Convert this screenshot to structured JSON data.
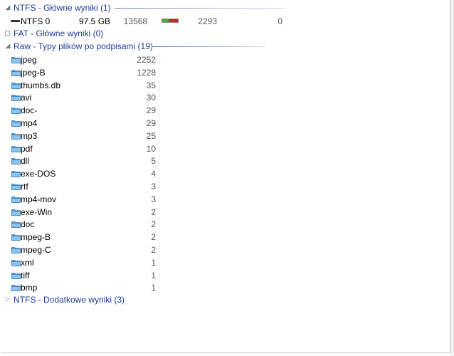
{
  "groups": {
    "ntfs_main": {
      "title": "NTFS - Główne wyniki (1)"
    },
    "fat_main": {
      "title": "FAT - Główne wyniki (0)"
    },
    "raw": {
      "title": "Raw - Typy plików po podpisami (19)"
    },
    "ntfs_extra": {
      "title": "NTFS - Dodatkowe wyniki (3)"
    }
  },
  "ntfs_row": {
    "name": "NTFS 0",
    "size": "97.5 GB",
    "value1": "13568",
    "bar_fill_fraction": 0.4,
    "value2": "2293",
    "value3": "0"
  },
  "raw_items": [
    {
      "name": "jpeg",
      "count": "2252"
    },
    {
      "name": "jpeg-B",
      "count": "1228"
    },
    {
      "name": "thumbs.db",
      "count": "35"
    },
    {
      "name": "avi",
      "count": "30"
    },
    {
      "name": "doc-",
      "count": "29"
    },
    {
      "name": "mp4",
      "count": "29"
    },
    {
      "name": "mp3",
      "count": "25"
    },
    {
      "name": "pdf",
      "count": "10"
    },
    {
      "name": "dll",
      "count": "5"
    },
    {
      "name": "exe-DOS",
      "count": "4"
    },
    {
      "name": "rtf",
      "count": "3"
    },
    {
      "name": "mp4-mov",
      "count": "3"
    },
    {
      "name": "exe-Win",
      "count": "2"
    },
    {
      "name": "doc",
      "count": "2"
    },
    {
      "name": "mpeg-B",
      "count": "2"
    },
    {
      "name": "mpeg-C",
      "count": "2"
    },
    {
      "name": "xml",
      "count": "1"
    },
    {
      "name": "tiff",
      "count": "1"
    },
    {
      "name": "bmp",
      "count": "1"
    }
  ],
  "icons": {
    "folder": "folder-icon",
    "drive": "drive-icon",
    "expand": "expand-arrow-icon",
    "collapse": "collapse-arrow-icon"
  },
  "colors": {
    "group_title": "#1e3c96",
    "folder": "#5aa0dc",
    "bar_used": "#d02020",
    "bar_free": "#3ab23a"
  }
}
